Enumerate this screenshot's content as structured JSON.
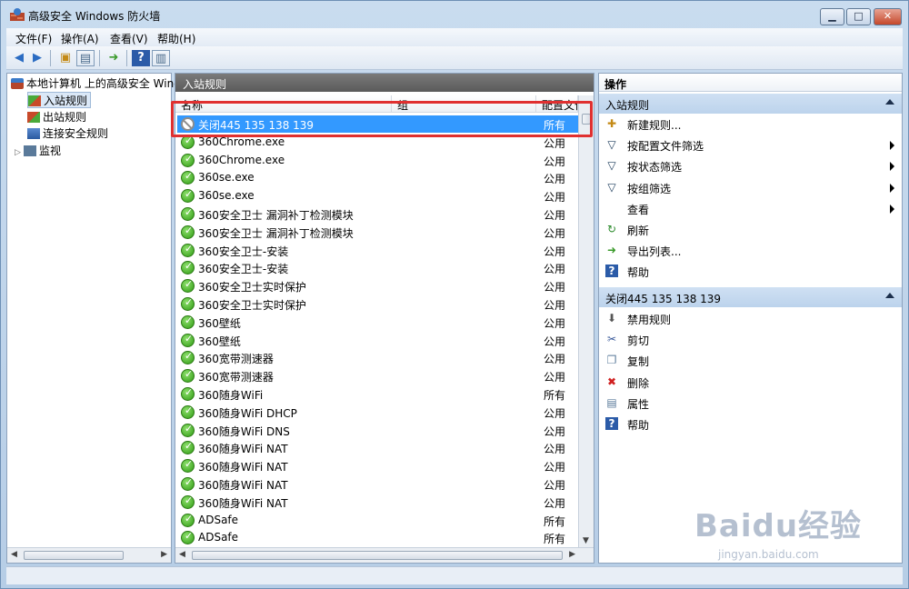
{
  "window": {
    "title": "高级安全 Windows 防火墙",
    "minimize": "▁",
    "maximize": "□",
    "close": "✕"
  },
  "menu": [
    "文件(F)",
    "操作(A)",
    "查看(V)",
    "帮助(H)"
  ],
  "tree": {
    "root": "本地计算机 上的高级安全 Wind",
    "items": [
      "入站规则",
      "出站规则",
      "连接安全规则",
      "监视"
    ]
  },
  "middle": {
    "header": "入站规则",
    "columns": [
      "名称",
      "组",
      "配置文件"
    ],
    "rows": [
      {
        "name": "关闭445 135 138 139",
        "profile": "所有",
        "status": "block"
      },
      {
        "name": "360Chrome.exe",
        "profile": "公用",
        "status": "allow"
      },
      {
        "name": "360Chrome.exe",
        "profile": "公用",
        "status": "allow"
      },
      {
        "name": "360se.exe",
        "profile": "公用",
        "status": "allow"
      },
      {
        "name": "360se.exe",
        "profile": "公用",
        "status": "allow"
      },
      {
        "name": "360安全卫士 漏洞补丁检测模块",
        "profile": "公用",
        "status": "allow"
      },
      {
        "name": "360安全卫士 漏洞补丁检测模块",
        "profile": "公用",
        "status": "allow"
      },
      {
        "name": "360安全卫士-安装",
        "profile": "公用",
        "status": "allow"
      },
      {
        "name": "360安全卫士-安装",
        "profile": "公用",
        "status": "allow"
      },
      {
        "name": "360安全卫士实时保护",
        "profile": "公用",
        "status": "allow"
      },
      {
        "name": "360安全卫士实时保护",
        "profile": "公用",
        "status": "allow"
      },
      {
        "name": "360壁纸",
        "profile": "公用",
        "status": "allow"
      },
      {
        "name": "360壁纸",
        "profile": "公用",
        "status": "allow"
      },
      {
        "name": "360宽带测速器",
        "profile": "公用",
        "status": "allow"
      },
      {
        "name": "360宽带测速器",
        "profile": "公用",
        "status": "allow"
      },
      {
        "name": "360随身WiFi",
        "profile": "所有",
        "status": "allow"
      },
      {
        "name": "360随身WiFi DHCP",
        "profile": "公用",
        "status": "allow"
      },
      {
        "name": "360随身WiFi DNS",
        "profile": "公用",
        "status": "allow"
      },
      {
        "name": "360随身WiFi NAT",
        "profile": "公用",
        "status": "allow"
      },
      {
        "name": "360随身WiFi NAT",
        "profile": "公用",
        "status": "allow"
      },
      {
        "name": "360随身WiFi NAT",
        "profile": "公用",
        "status": "allow"
      },
      {
        "name": "360随身WiFi NAT",
        "profile": "公用",
        "status": "allow"
      },
      {
        "name": "ADSafe",
        "profile": "所有",
        "status": "allow"
      },
      {
        "name": "ADSafe",
        "profile": "所有",
        "status": "allow"
      }
    ]
  },
  "actions": {
    "title": "操作",
    "section1": {
      "header": "入站规则",
      "items": [
        "新建规则...",
        "按配置文件筛选",
        "按状态筛选",
        "按组筛选",
        "查看",
        "刷新",
        "导出列表...",
        "帮助"
      ]
    },
    "section2": {
      "header": "关闭445 135 138 139",
      "items": [
        "禁用规则",
        "剪切",
        "复制",
        "删除",
        "属性",
        "帮助"
      ]
    }
  },
  "watermark": {
    "brand": "Baidu经验",
    "url": "jingyan.baidu.com"
  },
  "colors": {
    "selection": "#3399ff",
    "highlight_border": "#e03030",
    "allow_icon": "#2e9b12"
  }
}
